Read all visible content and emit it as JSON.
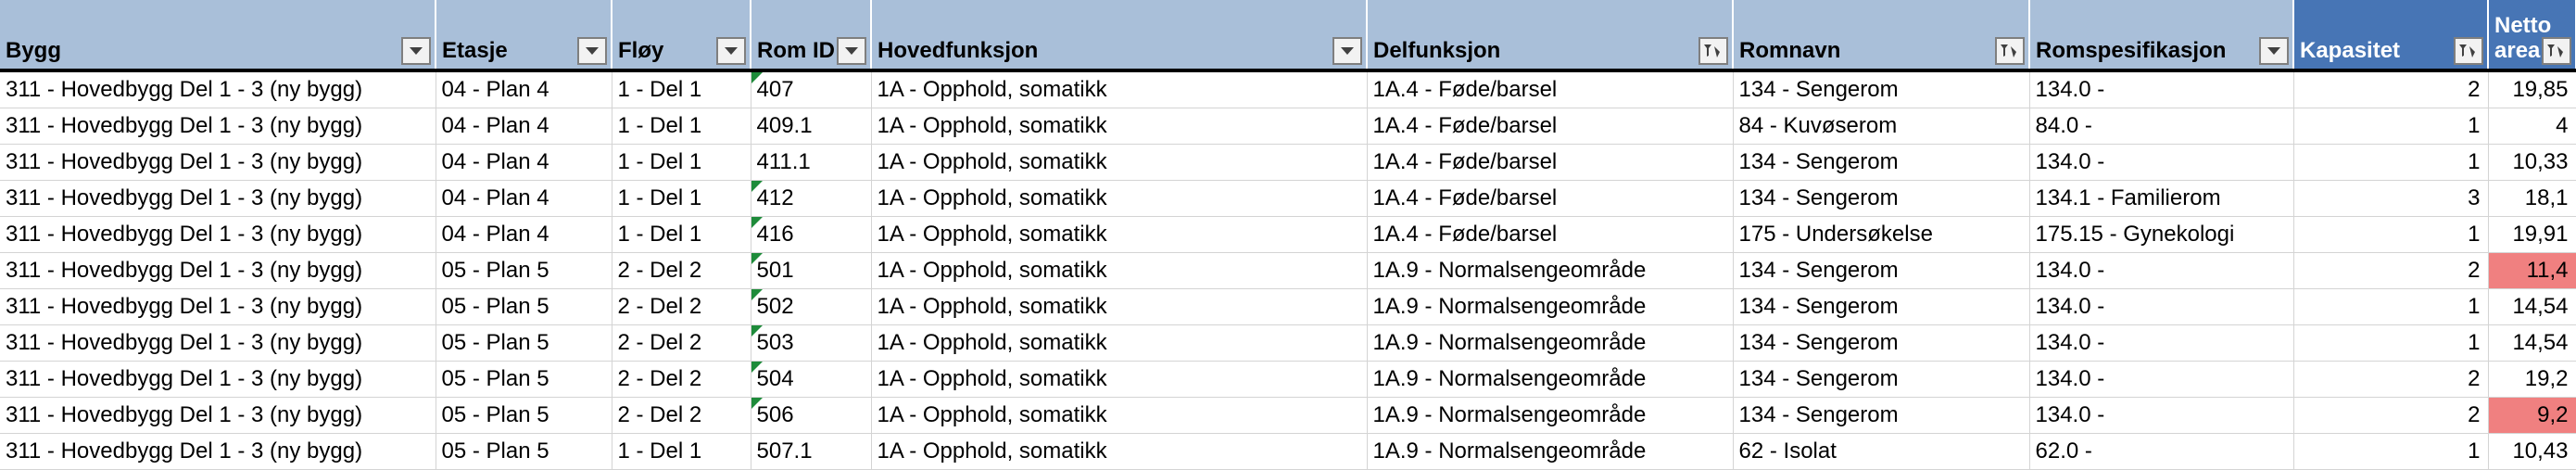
{
  "headers": [
    {
      "label": "Bygg",
      "filter": "dropdown"
    },
    {
      "label": "Etasje",
      "filter": "dropdown"
    },
    {
      "label": "Fløy",
      "filter": "dropdown"
    },
    {
      "label": "Rom ID",
      "filter": "dropdown"
    },
    {
      "label": "Hovedfunksjon",
      "filter": "dropdown"
    },
    {
      "label": "Delfunksjon",
      "filter": "filtered"
    },
    {
      "label": "Romnavn",
      "filter": "filtered"
    },
    {
      "label": "Romspesifikasjon",
      "filter": "dropdown"
    },
    {
      "label": "Kapasitet",
      "filter": "filtered"
    },
    {
      "label": "Netto areal",
      "filter": "filtered"
    }
  ],
  "rows": [
    {
      "bygg": "311 - Hovedbygg Del 1 - 3 (ny bygg)",
      "etasje": "04 - Plan 4",
      "floy": "1 - Del 1",
      "rom_id": "407",
      "hovedfunksjon": "1A - Opphold, somatikk",
      "delfunksjon": "1A.4 - Føde/barsel",
      "romnavn": "134 - Sengerom",
      "romspesifikasjon": "134.0 -",
      "kapasitet": "2",
      "netto_areal": "19,85",
      "comment_flag": true,
      "highlight": false
    },
    {
      "bygg": "311 - Hovedbygg Del 1 - 3 (ny bygg)",
      "etasje": "04 - Plan 4",
      "floy": "1 - Del 1",
      "rom_id": "409.1",
      "hovedfunksjon": "1A - Opphold, somatikk",
      "delfunksjon": "1A.4 - Føde/barsel",
      "romnavn": "84 - Kuvøserom",
      "romspesifikasjon": "84.0 -",
      "kapasitet": "1",
      "netto_areal": "4",
      "comment_flag": false,
      "highlight": false
    },
    {
      "bygg": "311 - Hovedbygg Del 1 - 3 (ny bygg)",
      "etasje": "04 - Plan 4",
      "floy": "1 - Del 1",
      "rom_id": "411.1",
      "hovedfunksjon": "1A - Opphold, somatikk",
      "delfunksjon": "1A.4 - Føde/barsel",
      "romnavn": "134 - Sengerom",
      "romspesifikasjon": "134.0 -",
      "kapasitet": "1",
      "netto_areal": "10,33",
      "comment_flag": false,
      "highlight": false
    },
    {
      "bygg": "311 - Hovedbygg Del 1 - 3 (ny bygg)",
      "etasje": "04 - Plan 4",
      "floy": "1 - Del 1",
      "rom_id": "412",
      "hovedfunksjon": "1A - Opphold, somatikk",
      "delfunksjon": "1A.4 - Føde/barsel",
      "romnavn": "134 - Sengerom",
      "romspesifikasjon": "134.1 - Familierom",
      "kapasitet": "3",
      "netto_areal": "18,1",
      "comment_flag": true,
      "highlight": false
    },
    {
      "bygg": "311 - Hovedbygg Del 1 - 3 (ny bygg)",
      "etasje": "04 - Plan 4",
      "floy": "1 - Del 1",
      "rom_id": "416",
      "hovedfunksjon": "1A - Opphold, somatikk",
      "delfunksjon": "1A.4 - Føde/barsel",
      "romnavn": "175 - Undersøkelse",
      "romspesifikasjon": "175.15 - Gynekologi",
      "kapasitet": "1",
      "netto_areal": "19,91",
      "comment_flag": true,
      "highlight": false
    },
    {
      "bygg": "311 - Hovedbygg Del 1 - 3 (ny bygg)",
      "etasje": "05 - Plan 5",
      "floy": "2 - Del 2",
      "rom_id": "501",
      "hovedfunksjon": "1A - Opphold, somatikk",
      "delfunksjon": "1A.9 - Normalsengeområde",
      "romnavn": "134 - Sengerom",
      "romspesifikasjon": "134.0 -",
      "kapasitet": "2",
      "netto_areal": "11,4",
      "comment_flag": true,
      "highlight": true
    },
    {
      "bygg": "311 - Hovedbygg Del 1 - 3 (ny bygg)",
      "etasje": "05 - Plan 5",
      "floy": "2 - Del 2",
      "rom_id": "502",
      "hovedfunksjon": "1A - Opphold, somatikk",
      "delfunksjon": "1A.9 - Normalsengeområde",
      "romnavn": "134 - Sengerom",
      "romspesifikasjon": "134.0 -",
      "kapasitet": "1",
      "netto_areal": "14,54",
      "comment_flag": true,
      "highlight": false
    },
    {
      "bygg": "311 - Hovedbygg Del 1 - 3 (ny bygg)",
      "etasje": "05 - Plan 5",
      "floy": "2 - Del 2",
      "rom_id": "503",
      "hovedfunksjon": "1A - Opphold, somatikk",
      "delfunksjon": "1A.9 - Normalsengeområde",
      "romnavn": "134 - Sengerom",
      "romspesifikasjon": "134.0 -",
      "kapasitet": "1",
      "netto_areal": "14,54",
      "comment_flag": true,
      "highlight": false
    },
    {
      "bygg": "311 - Hovedbygg Del 1 - 3 (ny bygg)",
      "etasje": "05 - Plan 5",
      "floy": "2 - Del 2",
      "rom_id": "504",
      "hovedfunksjon": "1A - Opphold, somatikk",
      "delfunksjon": "1A.9 - Normalsengeområde",
      "romnavn": "134 - Sengerom",
      "romspesifikasjon": "134.0 -",
      "kapasitet": "2",
      "netto_areal": "19,2",
      "comment_flag": true,
      "highlight": false
    },
    {
      "bygg": "311 - Hovedbygg Del 1 - 3 (ny bygg)",
      "etasje": "05 - Plan 5",
      "floy": "2 - Del 2",
      "rom_id": "506",
      "hovedfunksjon": "1A - Opphold, somatikk",
      "delfunksjon": "1A.9 - Normalsengeområde",
      "romnavn": "134 - Sengerom",
      "romspesifikasjon": "134.0 -",
      "kapasitet": "2",
      "netto_areal": "9,2",
      "comment_flag": true,
      "highlight": true
    },
    {
      "bygg": "311 - Hovedbygg Del 1 - 3 (ny bygg)",
      "etasje": "05 - Plan 5",
      "floy": "1 - Del 1",
      "rom_id": "507.1",
      "hovedfunksjon": "1A - Opphold, somatikk",
      "delfunksjon": "1A.9 - Normalsengeområde",
      "romnavn": "62 - Isolat",
      "romspesifikasjon": "62.0 -",
      "kapasitet": "1",
      "netto_areal": "10,43",
      "comment_flag": false,
      "highlight": false
    }
  ],
  "colors": {
    "header_light": "#a9bfd9",
    "header_dark": "#4775b5",
    "highlight_red": "#f08080",
    "comment_indicator": "#1e8b3a",
    "gridline": "#d4d4d4"
  },
  "icons": {
    "dropdown": "chevron-down-icon",
    "filtered": "filter-funnel-icon"
  }
}
